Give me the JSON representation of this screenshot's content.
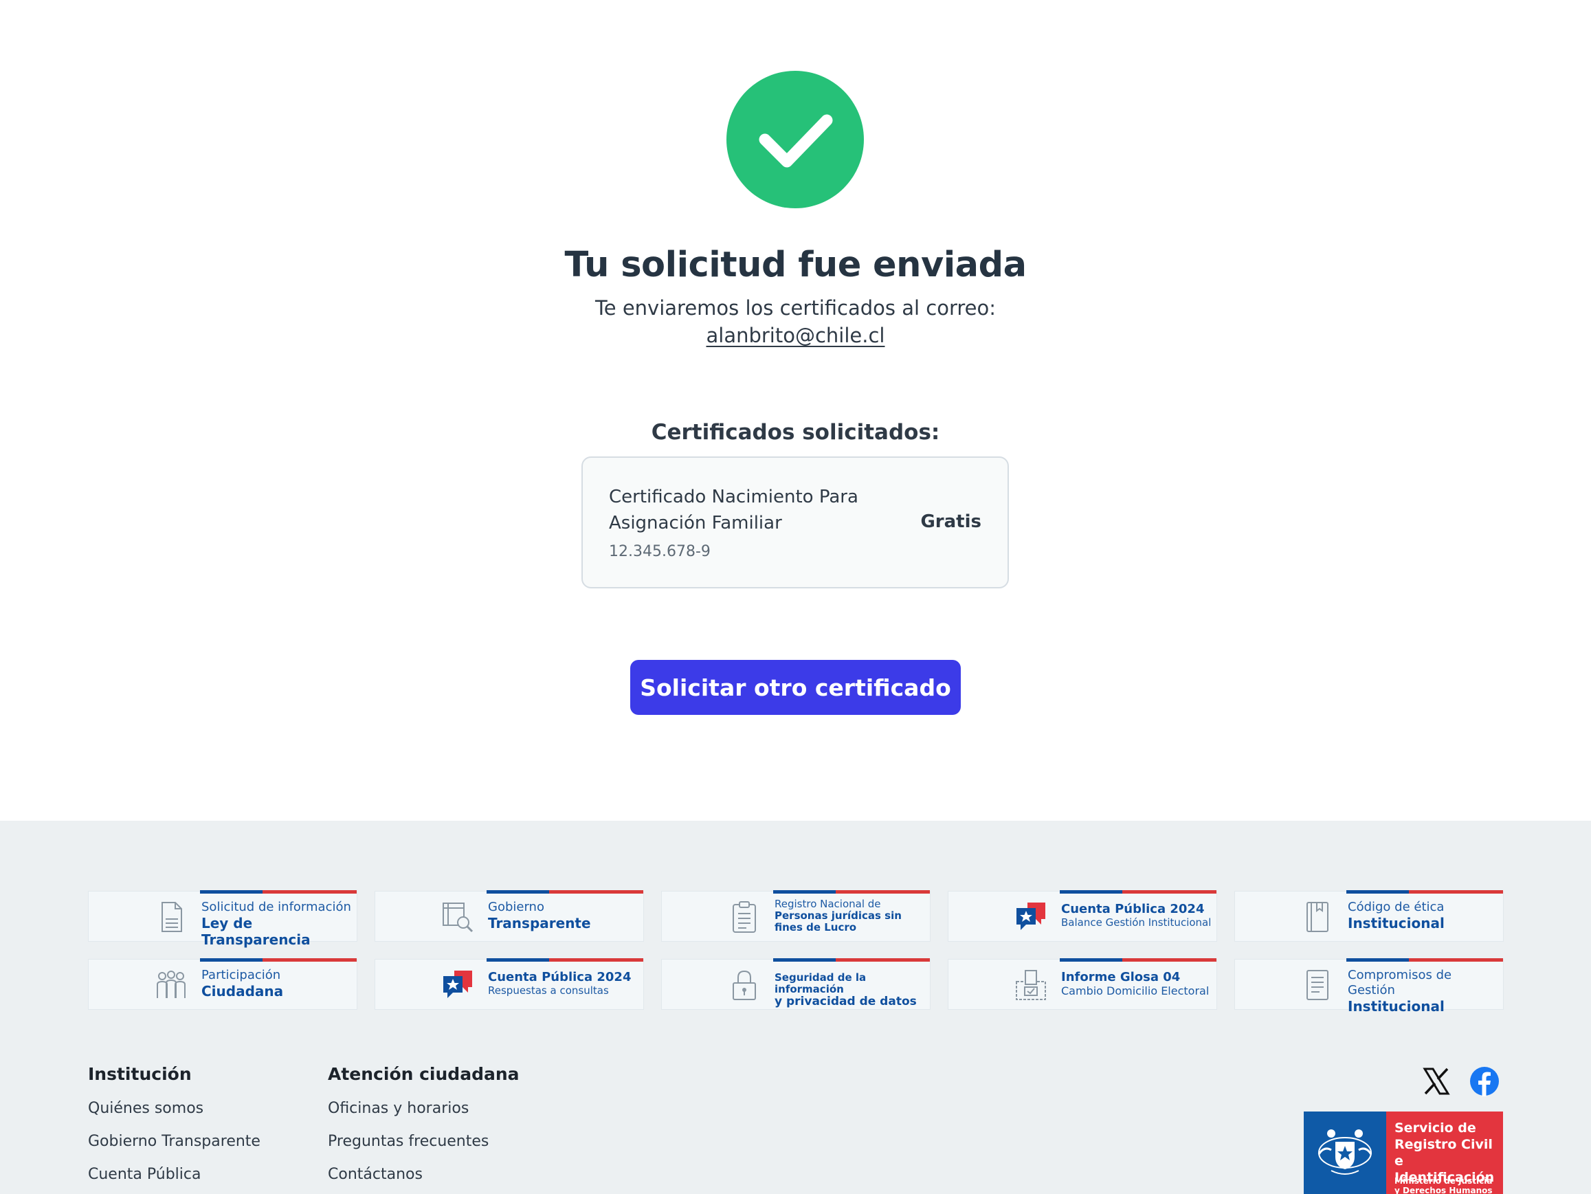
{
  "confirmation": {
    "title": "Tu solicitud fue enviada",
    "subtitle": "Te enviaremos los certificados al correo:",
    "email": "alanbrito@chile.cl"
  },
  "certificates": {
    "heading": "Certificados solicitados:",
    "items": [
      {
        "name": "Certificado Nacimiento Para Asignación Familiar",
        "rut": "12.345.678-9",
        "price": "Gratis"
      }
    ]
  },
  "actions": {
    "request_another": "Solicitar otro certificado"
  },
  "banners": [
    {
      "line1": "Solicitud de información",
      "line2": "Ley de Transparencia",
      "icon": "document-icon"
    },
    {
      "line1": "Gobierno",
      "line2": "Transparente",
      "icon": "magnifier-document-icon"
    },
    {
      "line1": "Registro Nacional de",
      "line2": "Personas jurídicas sin fines de Lucro",
      "icon": "clipboard-icon"
    },
    {
      "line1": "Cuenta Pública 2024",
      "line2": "Balance Gestión Institucional",
      "icon": "star-chat-icon"
    },
    {
      "line1": "Código de ética",
      "line2": "Institucional",
      "icon": "book-icon"
    },
    {
      "line1": "Participación",
      "line2": "Ciudadana",
      "icon": "people-icon"
    },
    {
      "line1": "Cuenta Pública 2024",
      "line2": "Respuestas a consultas",
      "icon": "star-chat-icon"
    },
    {
      "line1": "Seguridad de la información",
      "line2": "y privacidad de datos",
      "icon": "lock-icon"
    },
    {
      "line1": "Informe Glosa 04",
      "line2": "Cambio Domicilio Electoral",
      "icon": "ballot-box-icon"
    },
    {
      "line1": "Compromisos de Gestión",
      "line2": "Institucional",
      "icon": "list-document-icon"
    }
  ],
  "footer": {
    "institucion": {
      "heading": "Institución",
      "links": [
        "Quiénes somos",
        "Gobierno Transparente",
        "Cuenta Pública"
      ]
    },
    "atencion": {
      "heading": "Atención ciudadana",
      "links": [
        "Oficinas y horarios",
        "Preguntas frecuentes",
        "Contáctanos"
      ]
    },
    "logo": {
      "name": "Servicio de Registro Civil e Identificación",
      "ministry": "Ministerio de Justicia y Derechos Humanos"
    }
  },
  "colors": {
    "success": "#26c178",
    "primary_button": "#3c3be8",
    "footer_bg": "#ecf0f2",
    "gov_blue": "#0f4f9e",
    "gov_red": "#d93a3a"
  }
}
